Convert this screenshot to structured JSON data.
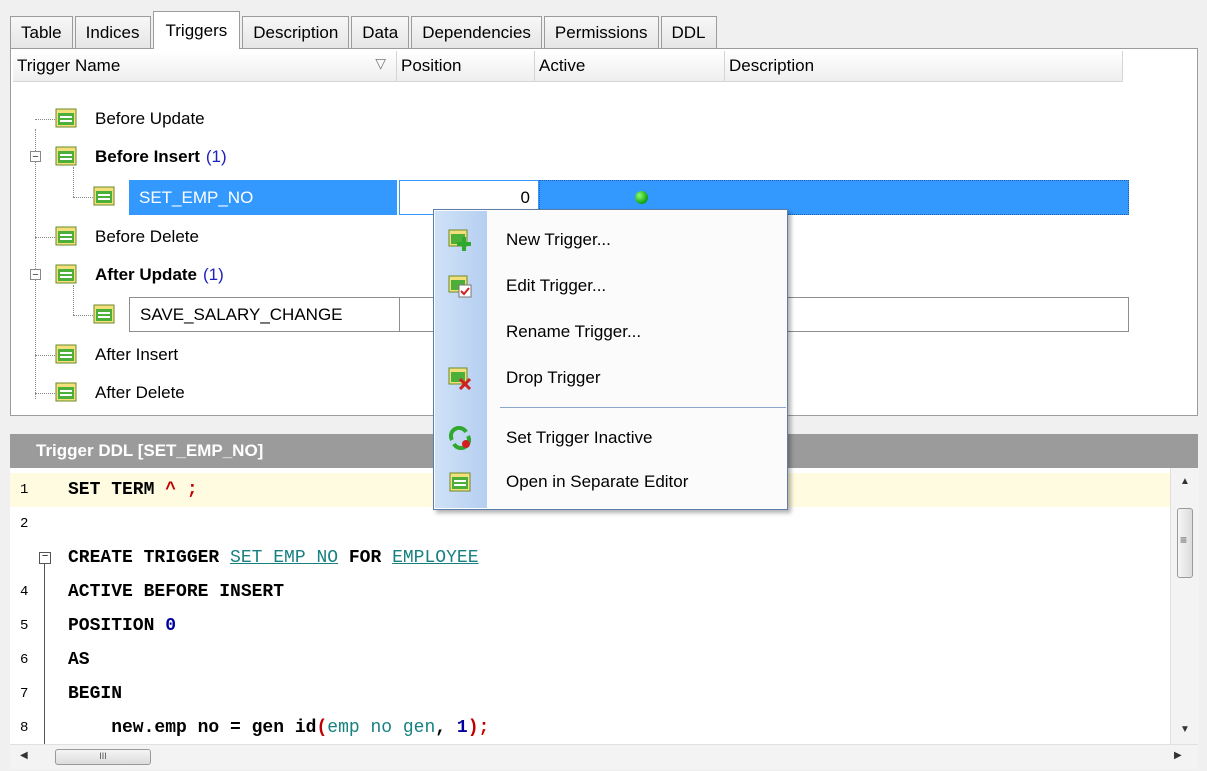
{
  "tabs": [
    {
      "label": "Table",
      "accel": "T"
    },
    {
      "label": "Indices",
      "accel": "I"
    },
    {
      "label": "Triggers",
      "accel": "r"
    },
    {
      "label": "Description",
      "accel": "D"
    },
    {
      "label": "Data",
      "accel": "a"
    },
    {
      "label": "Dependencies",
      "accel": "p"
    },
    {
      "label": "Permissions",
      "accel": "r"
    },
    {
      "label": "DDL",
      "accel": "L"
    }
  ],
  "grid": {
    "columns": [
      "Trigger Name",
      "Position",
      "Active",
      "Description"
    ],
    "sort_indicator": "▽",
    "groups": [
      {
        "label": "Before Update"
      },
      {
        "label": "Before Insert",
        "count": "(1)"
      },
      {
        "label": "Before Delete"
      },
      {
        "label": "After Update",
        "count": "(1)"
      },
      {
        "label": "After Insert"
      },
      {
        "label": "After Delete"
      }
    ],
    "selected_trigger": {
      "name": "SET_EMP_NO",
      "position": "0",
      "active": true
    },
    "edit_trigger": {
      "name": "SAVE_SALARY_CHANGE"
    }
  },
  "context_menu": {
    "items": [
      {
        "label": "New Trigger...",
        "icon": "new-trigger-icon"
      },
      {
        "label": "Edit Trigger...",
        "icon": "edit-trigger-icon"
      },
      {
        "label": "Rename Trigger...",
        "icon": ""
      },
      {
        "label": "Drop Trigger",
        "icon": "drop-trigger-icon"
      },
      {
        "label": "Set Trigger Inactive",
        "icon": "set-inactive-icon"
      },
      {
        "label": "Open in Separate Editor",
        "icon": "open-editor-icon"
      }
    ]
  },
  "ddl": {
    "title": "Trigger DDL [SET_EMP_NO]",
    "lines": [
      {
        "num": "1"
      },
      {
        "num": "2"
      },
      {
        "num": ""
      },
      {
        "num": "4"
      },
      {
        "num": "5"
      },
      {
        "num": "6"
      },
      {
        "num": "7"
      },
      {
        "num": "8"
      }
    ],
    "code": {
      "l1_a": "SET TERM ",
      "l1_b": "^ ;",
      "l3_a": "CREATE TRIGGER ",
      "l3_b": "SET EMP NO",
      "l3_c": " FOR ",
      "l3_d": "EMPLOYEE",
      "l4": "ACTIVE BEFORE INSERT",
      "l5_a": "POSITION ",
      "l5_b": "0",
      "l6": "AS",
      "l7": "BEGIN",
      "l8_a": "    new.emp no = gen id",
      "l8_b": "(",
      "l8_c": "emp no gen",
      "l8_d": ", ",
      "l8_e": "1",
      "l8_f": ");"
    }
  },
  "scrollbar": {
    "grip": "III",
    "vgrip": "≡"
  },
  "colors": {
    "selection": "#3399ff",
    "title_bar": "#9b9b9b",
    "current_line": "#fffbe0",
    "menu_strip": "#b5cff0"
  }
}
